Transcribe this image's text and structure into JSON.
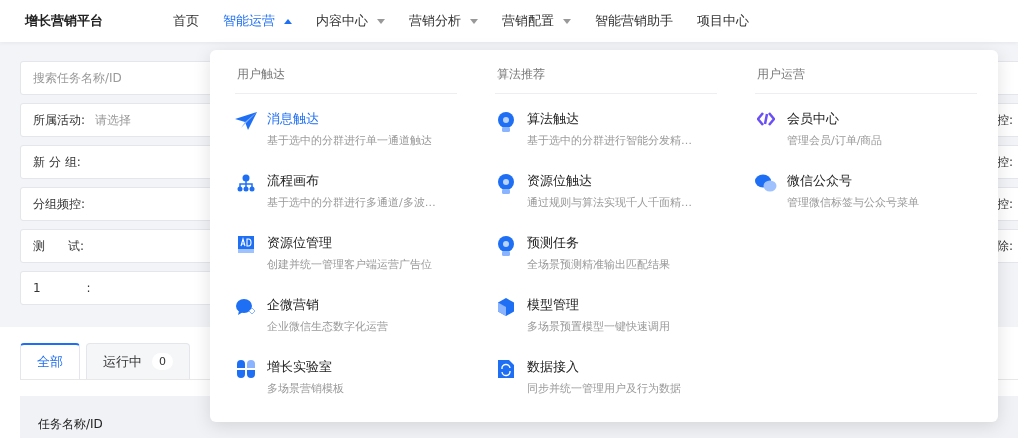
{
  "app_name": "增长营销平台",
  "nav": [
    {
      "label": "首页",
      "selected": false,
      "kind": "link"
    },
    {
      "label": "智能运营",
      "selected": true,
      "kind": "menu",
      "expanded": true
    },
    {
      "label": "内容中心",
      "selected": false,
      "kind": "menu",
      "expanded": false
    },
    {
      "label": "营销分析",
      "selected": false,
      "kind": "menu",
      "expanded": false
    },
    {
      "label": "营销配置",
      "selected": false,
      "kind": "menu",
      "expanded": false
    },
    {
      "label": "智能营销助手",
      "selected": false,
      "kind": "link"
    },
    {
      "label": "项目中心",
      "selected": false,
      "kind": "link"
    }
  ],
  "filters": [
    {
      "kind": "search",
      "placeholder": "搜索任务名称/ID"
    },
    {
      "kind": "select",
      "label": "所属活动:",
      "placeholder": "请选择"
    },
    {
      "kind": "input",
      "label": "新 分 组:"
    },
    {
      "kind": "input",
      "label": "分组频控:"
    },
    {
      "kind": "input",
      "label": "测      试:"
    },
    {
      "kind": "input",
      "label": "1            :"
    }
  ],
  "right_filters": [
    {
      "kind": "search"
    },
    {
      "kind": "input",
      "label": "控:"
    },
    {
      "kind": "input",
      "label": "控:"
    },
    {
      "kind": "input",
      "label": "控:"
    },
    {
      "kind": "input",
      "label": "除:"
    }
  ],
  "tabs": [
    {
      "label": "全部",
      "selected": true
    },
    {
      "label": "运行中",
      "count": "0",
      "selected": false
    }
  ],
  "table": {
    "columns": [
      "任务名称/ID"
    ]
  },
  "dropdown": {
    "groups": [
      {
        "title": "用户触达",
        "items": [
          {
            "title": "消息触达",
            "desc": "基于选中的分群进行单一通道触达",
            "selected": true
          },
          {
            "title": "流程画布",
            "desc": "基于选中的分群进行多通道/多波…",
            "selected": false
          },
          {
            "title": "资源位管理",
            "desc": "创建并统一管理客户端运营广告位",
            "selected": false
          },
          {
            "title": "企微营销",
            "desc": "企业微信生态数字化运营",
            "selected": false
          },
          {
            "title": "增长实验室",
            "desc": "多场景营销模板",
            "selected": false
          }
        ]
      },
      {
        "title": "算法推荐",
        "items": [
          {
            "title": "算法触达",
            "desc": "基于选中的分群进行智能分发精…",
            "selected": false
          },
          {
            "title": "资源位触达",
            "desc": "通过规则与算法实现千人千面精…",
            "selected": false
          },
          {
            "title": "预测任务",
            "desc": "全场景预测精准输出匹配结果",
            "selected": false
          },
          {
            "title": "模型管理",
            "desc": "多场景预置模型一键快速调用",
            "selected": false
          },
          {
            "title": "数据接入",
            "desc": "同步并统一管理用户及行为数据",
            "selected": false
          }
        ]
      },
      {
        "title": "用户运营",
        "items": [
          {
            "title": "会员中心",
            "desc": "管理会员/订单/商品",
            "selected": false
          },
          {
            "title": "微信公众号",
            "desc": "管理微信标签与公众号菜单",
            "selected": false
          }
        ]
      }
    ]
  }
}
